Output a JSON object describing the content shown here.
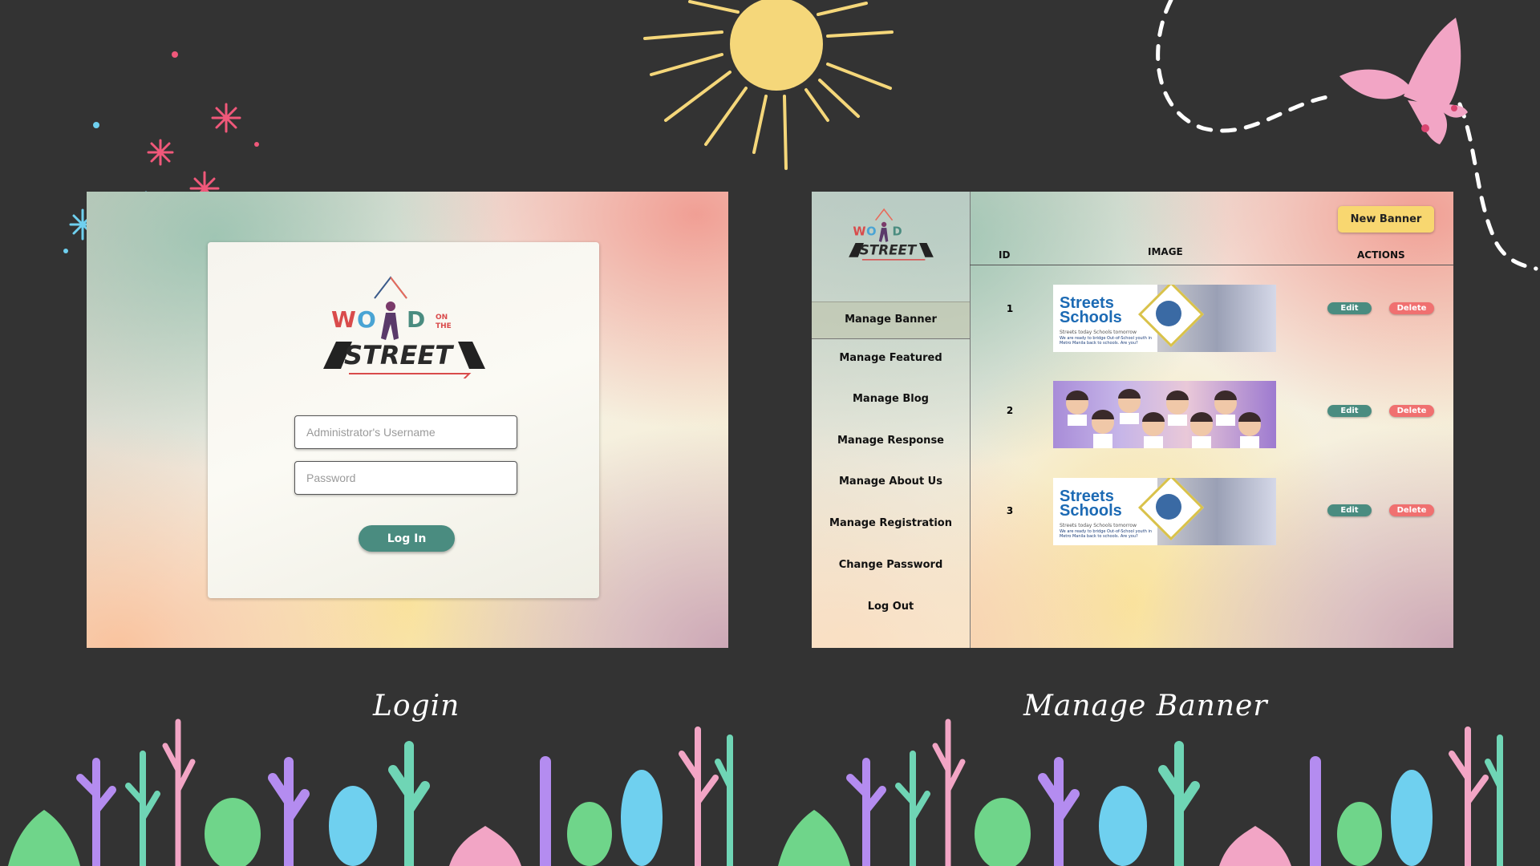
{
  "login": {
    "logo_text": "WORD ON THE STREET",
    "username_placeholder": "Administrator's Username",
    "password_placeholder": "Password",
    "login_button": "Log In"
  },
  "manage_banner": {
    "sidebar": {
      "items": [
        {
          "label": "Manage Banner",
          "active": true
        },
        {
          "label": "Manage Featured"
        },
        {
          "label": "Manage Blog"
        },
        {
          "label": "Manage Response"
        },
        {
          "label": "Manage About Us"
        },
        {
          "label": "Manage Registration"
        },
        {
          "label": "Change Password"
        },
        {
          "label": "Log Out"
        }
      ]
    },
    "new_banner_button": "New Banner",
    "table": {
      "headers": {
        "id": "ID",
        "image": "IMAGE",
        "actions": "ACTIONS"
      },
      "rows": [
        {
          "id": "1",
          "image_title": "Streets Schools",
          "image_sub": "Streets today Schools tomorrow",
          "image_line": "We are ready to bridge Out-of-School youth in Metro Manila back to schools. Are you?",
          "edit": "Edit",
          "delete": "Delete"
        },
        {
          "id": "2",
          "image_title": "",
          "edit": "Edit",
          "delete": "Delete"
        },
        {
          "id": "3",
          "image_title": "Streets Schools",
          "image_sub": "Streets today Schools tomorrow",
          "image_line": "We are ready to bridge Out-of-School youth in Metro Manila back to schools. Are you?",
          "edit": "Edit",
          "delete": "Delete"
        }
      ]
    }
  },
  "captions": {
    "login": "Login",
    "manage_banner": "Manage Banner"
  },
  "colors": {
    "background": "#333333",
    "teal": "#4a8c80",
    "yellow": "#f8d770",
    "red": "#f07070"
  }
}
